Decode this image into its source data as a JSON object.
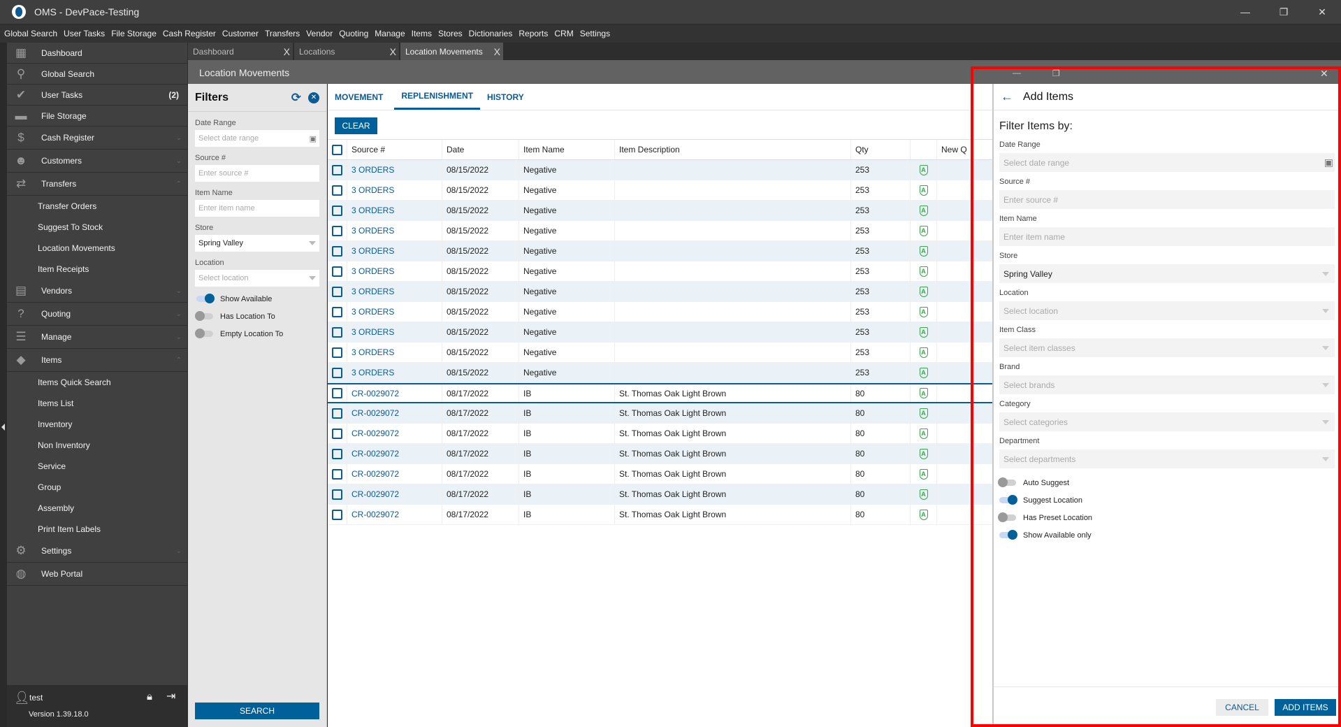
{
  "window": {
    "title": "OMS - DevPace-Testing",
    "minimize": "—",
    "restore": "❐",
    "close": "✕"
  },
  "menu": [
    "Global Search",
    "User Tasks",
    "File Storage",
    "Cash Register",
    "Customer",
    "Transfers",
    "Vendor",
    "Quoting",
    "Manage",
    "Items",
    "Stores",
    "Dictionaries",
    "Reports",
    "CRM",
    "Settings"
  ],
  "sidebar": {
    "items": [
      {
        "label": "Dashboard",
        "icon": "dashboard-icon",
        "glyph": "▦",
        "type": "main"
      },
      {
        "label": "Global Search",
        "icon": "search-icon",
        "glyph": "⚲",
        "type": "main"
      },
      {
        "label": "User Tasks",
        "icon": "check-circle-icon",
        "glyph": "✔",
        "type": "main",
        "badge": "(2)"
      },
      {
        "label": "File Storage",
        "icon": "folder-icon",
        "glyph": "▬",
        "type": "main"
      },
      {
        "label": "Cash Register",
        "icon": "dollar-icon",
        "glyph": "$",
        "type": "main",
        "chev": "⌄"
      },
      {
        "label": "Customers",
        "icon": "person-icon",
        "glyph": "☻",
        "type": "main",
        "chev": "⌄"
      },
      {
        "label": "Transfers",
        "icon": "transfer-icon",
        "glyph": "⇄",
        "type": "main",
        "chev": "⌃"
      },
      {
        "label": "Transfer Orders",
        "type": "sub"
      },
      {
        "label": "Suggest To Stock",
        "type": "sub"
      },
      {
        "label": "Location Movements",
        "type": "sub"
      },
      {
        "label": "Item Receipts",
        "type": "sub"
      },
      {
        "label": "Vendors",
        "icon": "store-icon",
        "glyph": "▤",
        "type": "main",
        "chev": "⌄"
      },
      {
        "label": "Quoting",
        "icon": "quote-icon",
        "glyph": "?",
        "type": "main",
        "chev": "⌄"
      },
      {
        "label": "Manage",
        "icon": "clipboard-icon",
        "glyph": "☰",
        "type": "main",
        "chev": "⌄"
      },
      {
        "label": "Items",
        "icon": "tag-icon",
        "glyph": "◆",
        "type": "main",
        "chev": "⌃"
      },
      {
        "label": "Items Quick Search",
        "type": "sub"
      },
      {
        "label": "Items List",
        "type": "sub"
      },
      {
        "label": "Inventory",
        "type": "sub"
      },
      {
        "label": "Non Inventory",
        "type": "sub"
      },
      {
        "label": "Service",
        "type": "sub"
      },
      {
        "label": "Group",
        "type": "sub"
      },
      {
        "label": "Assembly",
        "type": "sub"
      },
      {
        "label": "Print Item Labels",
        "type": "sub"
      },
      {
        "label": "Settings",
        "icon": "gear-icon",
        "glyph": "⚙",
        "type": "main",
        "chev": "⌄"
      },
      {
        "label": "Web Portal",
        "icon": "globe-icon",
        "glyph": "◍",
        "type": "main"
      }
    ],
    "user": "test",
    "version": "Version 1.39.18.0"
  },
  "tabs": [
    {
      "label": "Dashboard",
      "close": "X"
    },
    {
      "label": "Locations",
      "close": "X"
    },
    {
      "label": "Location Movements",
      "close": "X",
      "active": true
    }
  ],
  "page": {
    "title": "Location Movements"
  },
  "filters": {
    "title": "Filters",
    "date_label": "Date Range",
    "date_placeholder": "Select date range",
    "source_label": "Source #",
    "source_placeholder": "Enter source #",
    "item_label": "Item Name",
    "item_placeholder": "Enter item name",
    "store_label": "Store",
    "store_value": "Spring Valley",
    "location_label": "Location",
    "location_placeholder": "Select location",
    "toggles": [
      {
        "label": "Show Available",
        "on": true
      },
      {
        "label": "Has Location To",
        "on": false
      },
      {
        "label": "Empty Location To",
        "on": false
      }
    ],
    "search": "SEARCH"
  },
  "main": {
    "tabs": [
      "MOVEMENT",
      "REPLENISHMENT",
      "HISTORY"
    ],
    "active_tab": "REPLENISHMENT",
    "clear": "CLEAR",
    "columns": [
      "Source #",
      "Date",
      "Item Name",
      "Item Description",
      "Qty",
      "",
      "New Q"
    ],
    "rows": [
      [
        "3 ORDERS",
        "08/15/2022",
        "Negative",
        "",
        "253"
      ],
      [
        "3 ORDERS",
        "08/15/2022",
        "Negative",
        "",
        "253"
      ],
      [
        "3 ORDERS",
        "08/15/2022",
        "Negative",
        "",
        "253"
      ],
      [
        "3 ORDERS",
        "08/15/2022",
        "Negative",
        "",
        "253"
      ],
      [
        "3 ORDERS",
        "08/15/2022",
        "Negative",
        "",
        "253"
      ],
      [
        "3 ORDERS",
        "08/15/2022",
        "Negative",
        "",
        "253"
      ],
      [
        "3 ORDERS",
        "08/15/2022",
        "Negative",
        "",
        "253"
      ],
      [
        "3 ORDERS",
        "08/15/2022",
        "Negative",
        "",
        "253"
      ],
      [
        "3 ORDERS",
        "08/15/2022",
        "Negative",
        "",
        "253"
      ],
      [
        "3 ORDERS",
        "08/15/2022",
        "Negative",
        "",
        "253"
      ],
      [
        "3 ORDERS",
        "08/15/2022",
        "Negative",
        "",
        "253"
      ],
      [
        "CR-0029072",
        "08/17/2022",
        "IB",
        "St. Thomas Oak Light Brown",
        "80"
      ],
      [
        "CR-0029072",
        "08/17/2022",
        "IB",
        "St. Thomas Oak Light Brown",
        "80"
      ],
      [
        "CR-0029072",
        "08/17/2022",
        "IB",
        "St. Thomas Oak Light Brown",
        "80"
      ],
      [
        "CR-0029072",
        "08/17/2022",
        "IB",
        "St. Thomas Oak Light Brown",
        "80"
      ],
      [
        "CR-0029072",
        "08/17/2022",
        "IB",
        "St. Thomas Oak Light Brown",
        "80"
      ],
      [
        "CR-0029072",
        "08/17/2022",
        "IB",
        "St. Thomas Oak Light Brown",
        "80"
      ],
      [
        "CR-0029072",
        "08/17/2022",
        "IB",
        "St. Thomas Oak Light Brown",
        "80"
      ]
    ],
    "row_badge": "A",
    "selected_row": 11
  },
  "modal": {
    "title": "Add Items",
    "back": "←",
    "subtitle": "Filter Items by:",
    "fields": [
      {
        "label": "Date Range",
        "placeholder": "Select date range",
        "kind": "date"
      },
      {
        "label": "Source #",
        "placeholder": "Enter source #",
        "kind": "text"
      },
      {
        "label": "Item Name",
        "placeholder": "Enter item name",
        "kind": "text"
      },
      {
        "label": "Store",
        "value": "Spring Valley",
        "kind": "select"
      },
      {
        "label": "Location",
        "placeholder": "Select location",
        "kind": "select"
      },
      {
        "label": "Item Class",
        "placeholder": "Select item classes",
        "kind": "select"
      },
      {
        "label": "Brand",
        "placeholder": "Select brands",
        "kind": "select"
      },
      {
        "label": "Category",
        "placeholder": "Select categories",
        "kind": "select"
      },
      {
        "label": "Department",
        "placeholder": "Select departments",
        "kind": "select"
      }
    ],
    "toggles": [
      {
        "label": "Auto Suggest",
        "on": false
      },
      {
        "label": "Suggest Location",
        "on": true
      },
      {
        "label": "Has Preset Location",
        "on": false
      },
      {
        "label": "Show Available only",
        "on": true
      }
    ],
    "cancel": "CANCEL",
    "add": "ADD ITEMS"
  },
  "colors": {
    "accent": "#006099",
    "highlight": "#ff0000",
    "badge": "#3aa64a"
  }
}
